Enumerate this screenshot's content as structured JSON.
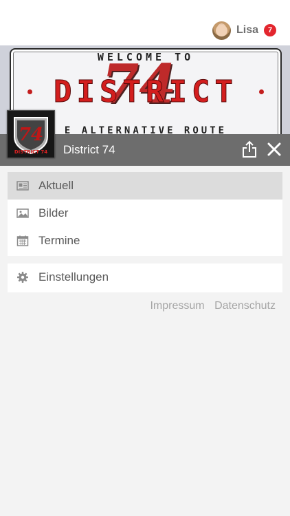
{
  "user": {
    "name": "Lisa",
    "notification_count": "7"
  },
  "banner": {
    "line1": "WELCOME TO",
    "big": "74",
    "district": "DISTRICT",
    "line3": "E ALTERNATIVE ROUTE",
    "logo_number": "74",
    "logo_text": "DISTRICT 74"
  },
  "app": {
    "title": "District 74"
  },
  "menu": {
    "items": [
      {
        "label": "Aktuell",
        "icon": "newspaper-icon",
        "active": true
      },
      {
        "label": "Bilder",
        "icon": "image-icon",
        "active": false
      },
      {
        "label": "Termine",
        "icon": "calendar-icon",
        "active": false
      }
    ],
    "settings": {
      "label": "Einstellungen",
      "icon": "gear-icon"
    }
  },
  "footer": {
    "impressum": "Impressum",
    "datenschutz": "Datenschutz"
  },
  "colors": {
    "header_bg": "#6d6d6d",
    "accent_red": "#e3262e",
    "active_row": "#dcdcdc",
    "footer_text": "#a5a5a5"
  }
}
